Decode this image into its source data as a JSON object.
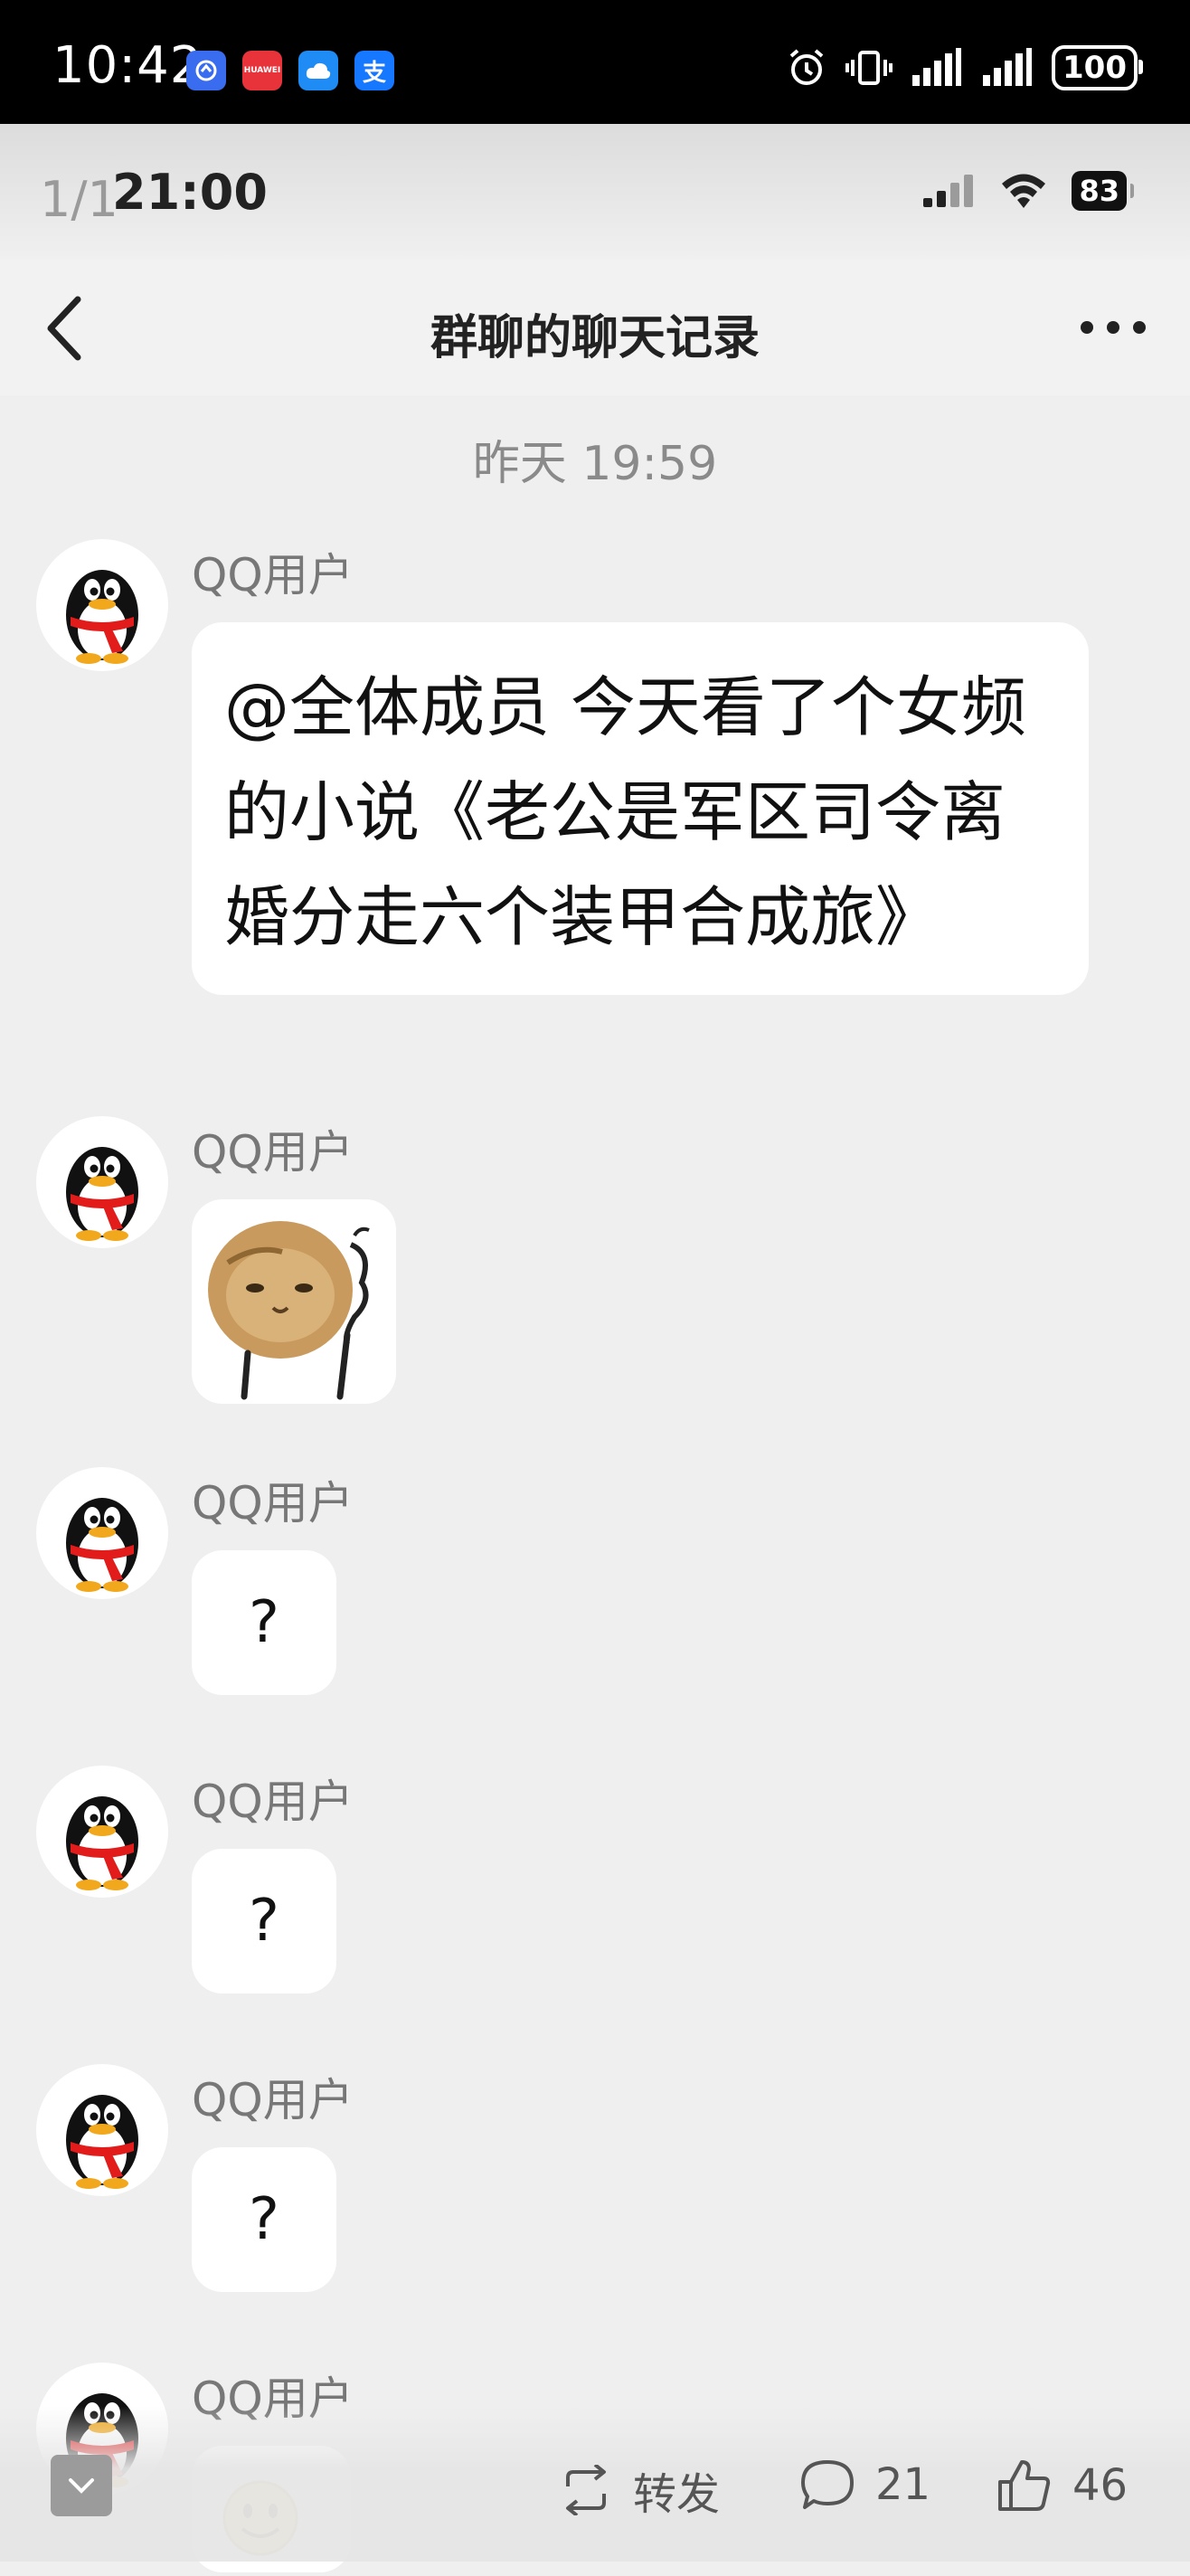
{
  "outer_status": {
    "time": "10:42",
    "battery": "100",
    "huawei_label": "HUAWEI",
    "alipay_glyph": "支"
  },
  "inner_status": {
    "page_counter": "1/1",
    "time": "21:00",
    "battery": "83"
  },
  "nav": {
    "title": "群聊的聊天记录"
  },
  "chat": {
    "timestamp": "昨天 19:59",
    "messages": [
      {
        "sender": "QQ用户",
        "type": "text",
        "text": "@全体成员 今天看了个女频的小说《老公是军区司令离婚分走六个装甲合成旅》"
      },
      {
        "sender": "QQ用户",
        "type": "sticker",
        "sticker": "cat-thinking-sticker"
      },
      {
        "sender": "QQ用户",
        "type": "text",
        "text": "?"
      },
      {
        "sender": "QQ用户",
        "type": "text",
        "text": "?"
      },
      {
        "sender": "QQ用户",
        "type": "text",
        "text": "?"
      },
      {
        "sender": "QQ用户",
        "type": "emoji",
        "emoji": "smile-emoji"
      }
    ]
  },
  "bottom_bar": {
    "forward_label": "转发",
    "comment_count": "21",
    "like_count": "46"
  },
  "colors": {
    "background": "#efefef",
    "bubble": "#ffffff",
    "penguin_scarf": "#e21b1b",
    "penguin_beak": "#f2a81c"
  }
}
